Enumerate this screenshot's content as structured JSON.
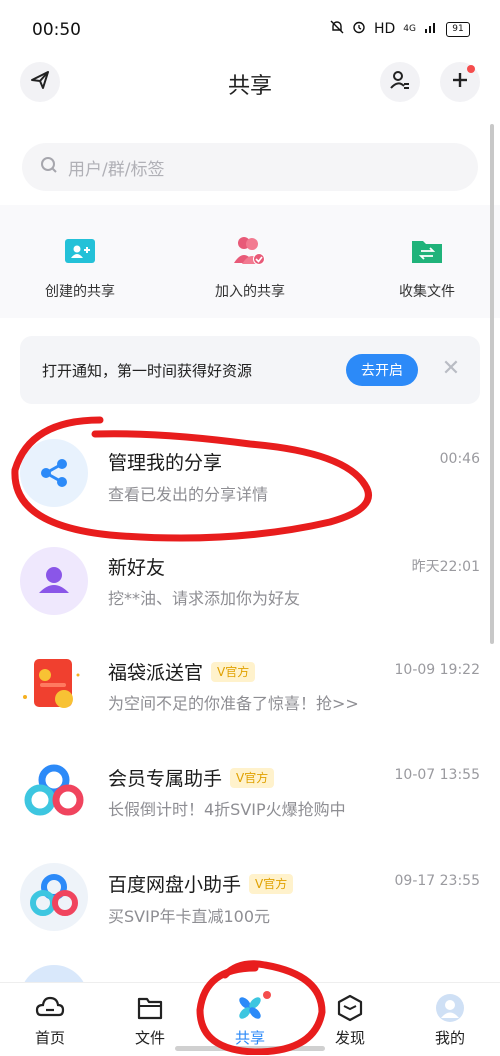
{
  "status_bar": {
    "time": "00:50",
    "network": "HD",
    "signal": "4G",
    "battery": "91"
  },
  "header": {
    "title": "共享"
  },
  "search": {
    "placeholder": "用户/群/标签"
  },
  "quick_actions": [
    {
      "label": "创建的共享"
    },
    {
      "label": "加入的共享"
    },
    {
      "label": "收集文件"
    }
  ],
  "notice": {
    "text": "打开通知，第一时间获得好资源",
    "button": "去开启",
    "close": "✕"
  },
  "list": [
    {
      "name": "管理我的分享",
      "subtitle": "查看已发出的分享详情",
      "time": "00:46"
    },
    {
      "name": "新好友",
      "subtitle": "挖**油、请求添加你为好友",
      "time": "昨天22:01"
    },
    {
      "name": "福袋派送官",
      "badge": "V官方",
      "subtitle": "为空间不足的你准备了惊喜！抢>>",
      "time": "10-09 19:22"
    },
    {
      "name": "会员专属助手",
      "badge": "V官方",
      "subtitle": "长假倒计时！4折SVIP火爆抢购中",
      "time": "10-07 13:55"
    },
    {
      "name": "百度网盘小助手",
      "badge": "V官方",
      "subtitle": "买SVIP年卡直减100元",
      "time": "09-17 23:55"
    }
  ],
  "nav": [
    {
      "label": "首页"
    },
    {
      "label": "文件"
    },
    {
      "label": "共享"
    },
    {
      "label": "发现"
    },
    {
      "label": "我的"
    }
  ],
  "colors": {
    "accent": "#2c8af8",
    "annotation": "#e81d1d"
  }
}
